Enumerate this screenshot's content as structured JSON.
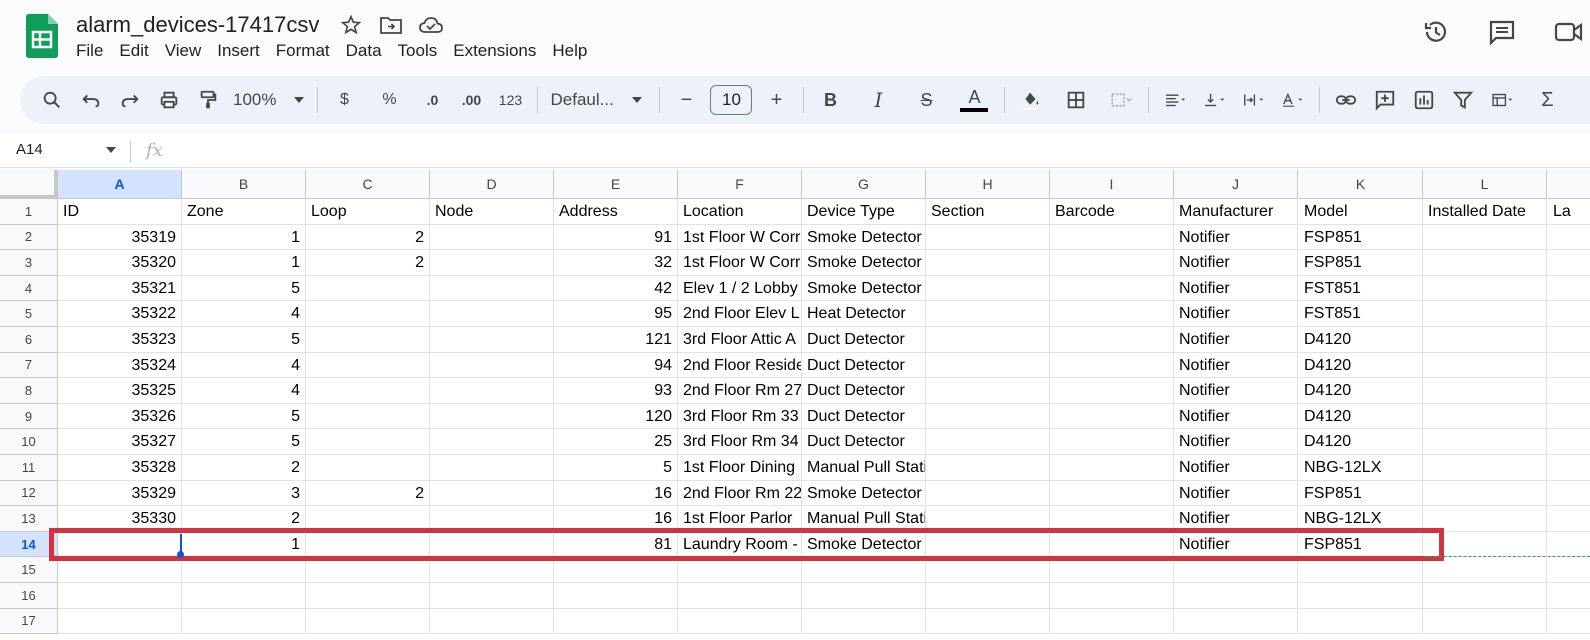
{
  "document": {
    "title": "alarm_devices-17417csv"
  },
  "menu": [
    "File",
    "Edit",
    "View",
    "Insert",
    "Format",
    "Data",
    "Tools",
    "Extensions",
    "Help"
  ],
  "toolbar": {
    "zoom": "100%",
    "currency": "$",
    "percent": "%",
    "dec_decrease": ".0",
    "dec_increase": ".00",
    "number_format": "123",
    "font": "Defaul...",
    "font_size": "10",
    "minus": "−",
    "plus": "+",
    "bold": "B",
    "italic": "I",
    "strike": "S",
    "text_color": "A",
    "sum": "Σ"
  },
  "formula_bar": {
    "name_box": "A14",
    "fx": "fx"
  },
  "columns": [
    "A",
    "B",
    "C",
    "D",
    "E",
    "F",
    "G",
    "H",
    "I",
    "J",
    "K",
    "L"
  ],
  "row_numbers": [
    "1",
    "2",
    "3",
    "4",
    "5",
    "6",
    "7",
    "8",
    "9",
    "10",
    "11",
    "12",
    "13",
    "14",
    "15",
    "16",
    "17"
  ],
  "selected_column": "A",
  "selected_row": "14",
  "rows": [
    [
      "ID",
      "Zone",
      "Loop",
      "Node",
      "Address",
      "Location",
      "Device Type",
      "Section",
      "Barcode",
      "Manufacturer",
      "Model",
      "Installed Date",
      "La"
    ],
    [
      "35319",
      "1",
      "2",
      "",
      "91",
      "1st Floor W Corr",
      "Smoke Detector",
      "",
      "",
      "Notifier",
      "FSP851",
      "",
      ""
    ],
    [
      "35320",
      "1",
      "2",
      "",
      "32",
      "1st Floor W Corr",
      "Smoke Detector",
      "",
      "",
      "Notifier",
      "FSP851",
      "",
      ""
    ],
    [
      "35321",
      "5",
      "",
      "",
      "42",
      "Elev 1 / 2 Lobby",
      "Smoke Detector",
      "",
      "",
      "Notifier",
      "FST851",
      "",
      ""
    ],
    [
      "35322",
      "4",
      "",
      "",
      "95",
      "2nd Floor Elev L",
      "Heat Detector",
      "",
      "",
      "Notifier",
      "FST851",
      "",
      ""
    ],
    [
      "35323",
      "5",
      "",
      "",
      "121",
      "3rd Floor Attic A",
      "Duct Detector",
      "",
      "",
      "Notifier",
      "D4120",
      "",
      ""
    ],
    [
      "35324",
      "4",
      "",
      "",
      "94",
      "2nd Floor Reside",
      "Duct Detector",
      "",
      "",
      "Notifier",
      "D4120",
      "",
      ""
    ],
    [
      "35325",
      "4",
      "",
      "",
      "93",
      "2nd Floor Rm 27",
      "Duct Detector",
      "",
      "",
      "Notifier",
      "D4120",
      "",
      ""
    ],
    [
      "35326",
      "5",
      "",
      "",
      "120",
      "3rd Floor Rm 33",
      "Duct Detector",
      "",
      "",
      "Notifier",
      "D4120",
      "",
      ""
    ],
    [
      "35327",
      "5",
      "",
      "",
      "25",
      "3rd Floor Rm 34",
      "Duct Detector",
      "",
      "",
      "Notifier",
      "D4120",
      "",
      ""
    ],
    [
      "35328",
      "2",
      "",
      "",
      "5",
      "1st Floor Dining",
      "Manual Pull Station",
      "",
      "",
      "Notifier",
      "NBG-12LX",
      "",
      ""
    ],
    [
      "35329",
      "3",
      "2",
      "",
      "16",
      "2nd Floor Rm 22",
      "Smoke Detector",
      "",
      "",
      "Notifier",
      "FSP851",
      "",
      ""
    ],
    [
      "35330",
      "2",
      "",
      "",
      "16",
      "1st Floor Parlor",
      "Manual Pull Station",
      "",
      "",
      "Notifier",
      "NBG-12LX",
      "",
      ""
    ],
    [
      "",
      "1",
      "",
      "",
      "81",
      "Laundry Room -",
      "Smoke Detector",
      "",
      "",
      "Notifier",
      "FSP851",
      "",
      ""
    ],
    [
      "",
      "",
      "",
      "",
      "",
      "",
      "",
      "",
      "",
      "",
      "",
      "",
      ""
    ],
    [
      "",
      "",
      "",
      "",
      "",
      "",
      "",
      "",
      "",
      "",
      "",
      "",
      ""
    ],
    [
      "",
      "",
      "",
      "",
      "",
      "",
      "",
      "",
      "",
      "",
      "",
      "",
      ""
    ]
  ],
  "colors": {
    "highlight": "#d1343f",
    "selection": "#d3e3fd",
    "accent": "#0b57d0",
    "sheets_green": "#0f9d58"
  }
}
